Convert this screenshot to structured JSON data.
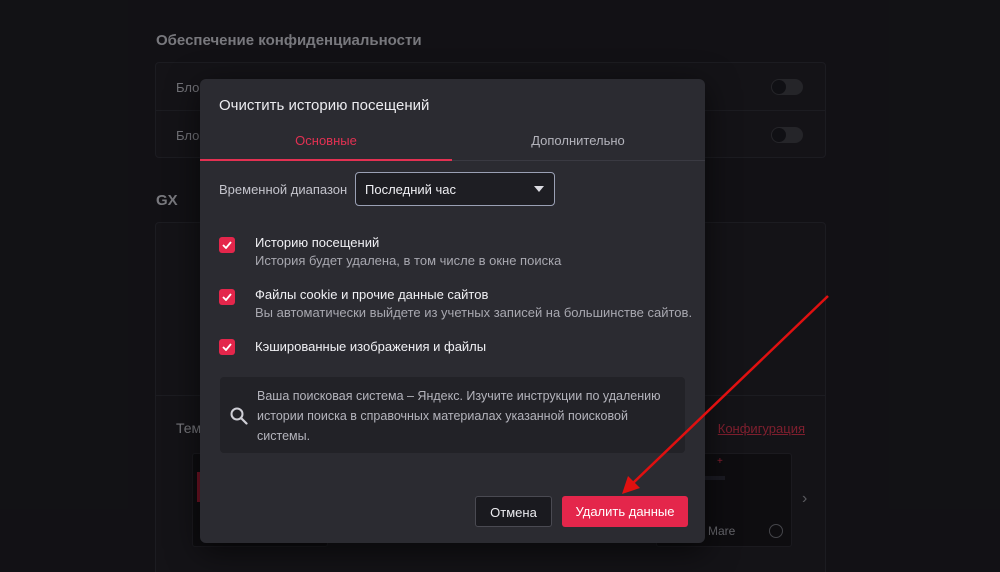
{
  "background": {
    "privacy_title": "Обеспечение конфиденциальности",
    "rows": [
      {
        "label": "Блок"
      },
      {
        "label": "Блок"
      }
    ],
    "gx_title": "GX",
    "theme_label": "Тем",
    "config_link": "Конфигурация",
    "theme_name": "i Mare"
  },
  "dialog": {
    "title": "Очистить историю посещений",
    "tabs": [
      {
        "label": "Основные",
        "active": true
      },
      {
        "label": "Дополнительно",
        "active": false
      }
    ],
    "time_range": {
      "label": "Временной диапазон",
      "value": "Последний час"
    },
    "items": [
      {
        "title": "Историю посещений",
        "description": "История будет удалена, в том числе в окне поиска",
        "checked": true
      },
      {
        "title": "Файлы cookie и прочие данные сайтов",
        "description": "Вы автоматически выйдете из учетных записей на большинстве сайтов.",
        "checked": true
      },
      {
        "title": "Кэшированные изображения и файлы",
        "description": "",
        "checked": true
      }
    ],
    "info": {
      "icon": "search-icon",
      "text": "Ваша поисковая система – Яндекс. Изучите инструкции по удалению истории поиска в справочных материалах указанной поисковой системы."
    },
    "buttons": {
      "cancel": "Отмена",
      "delete": "Удалить данные"
    }
  },
  "colors": {
    "accent": "#e4264b",
    "background": "#1c1b21",
    "dialog": "#2b2b31",
    "annotation_arrow": "#e01010"
  }
}
